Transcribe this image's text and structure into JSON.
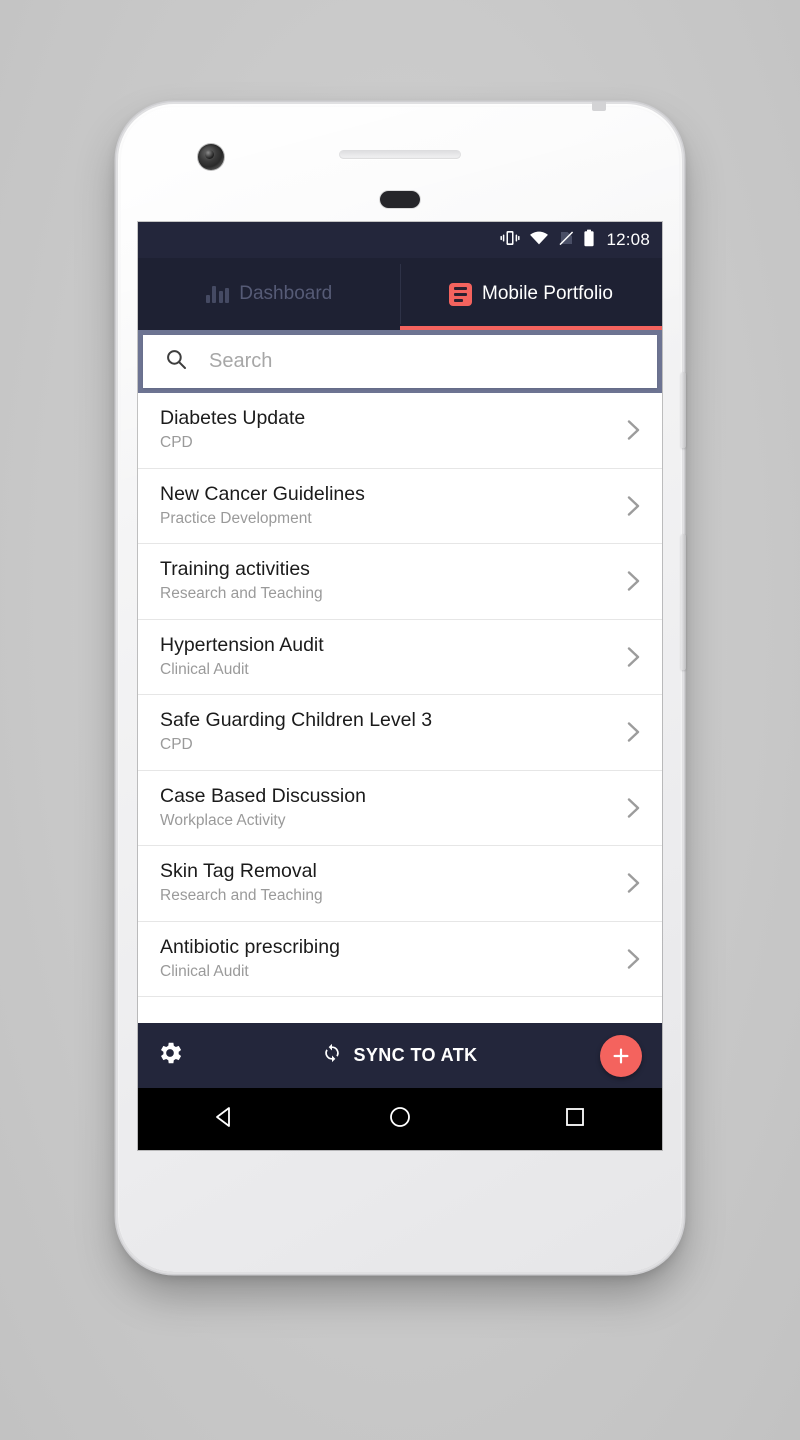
{
  "device": {
    "name": "android-smartphone-white",
    "camera_icon": "camera-icon",
    "earpiece_icon": "earpiece-speaker",
    "proximity_icon": "proximity-sensor",
    "power_button": "power-button",
    "volume_button": "volume-button"
  },
  "status_bar": {
    "icons": [
      "vibrate-icon",
      "wifi-icon",
      "no-sim-icon",
      "battery-icon"
    ],
    "time": "12:08",
    "background": "#23263b"
  },
  "tabs": [
    {
      "label": "Dashboard",
      "icon": "bar-chart-icon",
      "active": false
    },
    {
      "label": "Mobile Portfolio",
      "icon": "article-icon",
      "active": true
    }
  ],
  "accent_color": "#f4635e",
  "search": {
    "placeholder": "Search",
    "value": "",
    "icon": "search-icon"
  },
  "list": {
    "items": [
      {
        "title": "Diabetes Update",
        "subtitle": "CPD"
      },
      {
        "title": "New Cancer Guidelines",
        "subtitle": "Practice Development"
      },
      {
        "title": "Training activities",
        "subtitle": "Research and Teaching"
      },
      {
        "title": "Hypertension Audit",
        "subtitle": "Clinical Audit"
      },
      {
        "title": "Safe Guarding Children Level 3",
        "subtitle": "CPD"
      },
      {
        "title": "Case Based Discussion",
        "subtitle": "Workplace Activity"
      },
      {
        "title": "Skin Tag Removal",
        "subtitle": "Research and Teaching"
      },
      {
        "title": "Antibiotic prescribing",
        "subtitle": "Clinical Audit"
      }
    ],
    "chevron_icon": "chevron-right-icon"
  },
  "action_bar": {
    "settings_icon": "gear-icon",
    "sync_icon": "sync-icon",
    "sync_label": "SYNC TO ATK",
    "add_icon": "plus-icon",
    "background": "#23263b"
  },
  "nav_bar": {
    "back_icon": "back-triangle-icon",
    "home_icon": "home-circle-icon",
    "recents_icon": "recents-square-icon"
  }
}
